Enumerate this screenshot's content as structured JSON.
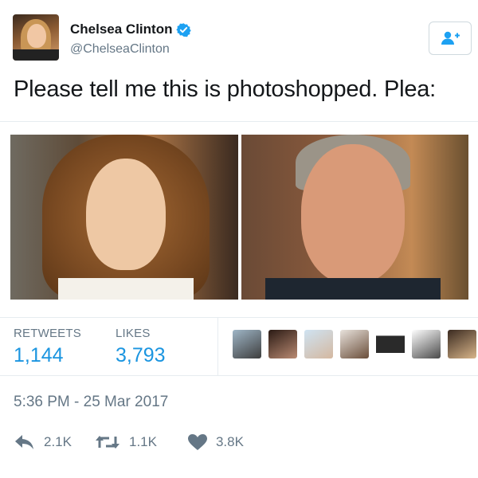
{
  "author": {
    "display_name": "Chelsea Clinton",
    "handle": "@ChelseaClinton",
    "verified": true
  },
  "tweet": {
    "text": "Please tell me this is photoshopped. Plea:"
  },
  "stats": {
    "retweets_label": "RETWEETS",
    "retweets_value": "1,144",
    "likes_label": "LIKES",
    "likes_value": "3,793"
  },
  "timestamp": "5:36 PM - 25 Mar 2017",
  "actions": {
    "reply_count": "2.1K",
    "retweet_count": "1.1K",
    "like_count": "3.8K"
  },
  "colors": {
    "accent": "#1b95e0",
    "muted": "#657786",
    "verified": "#1da1f2"
  },
  "icons": [
    "verified-icon",
    "follow-user-icon",
    "reply-icon",
    "retweet-icon",
    "heart-icon"
  ]
}
